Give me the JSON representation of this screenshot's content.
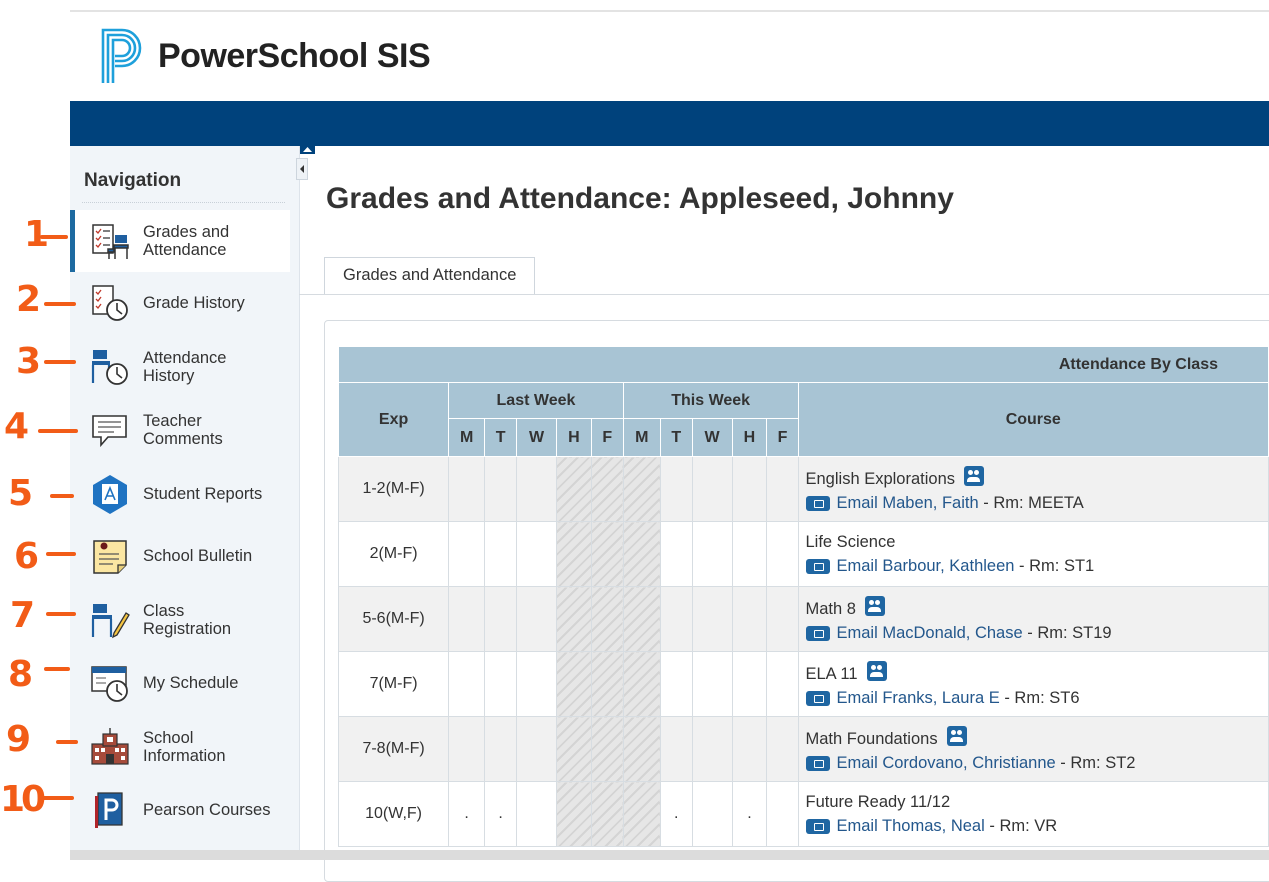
{
  "app": {
    "logo_text": "PowerSchool SIS"
  },
  "sidebar": {
    "title": "Navigation",
    "items": [
      {
        "label": "Grades and Attendance",
        "icon": "grades-attendance-icon"
      },
      {
        "label": "Grade History",
        "icon": "grade-history-icon"
      },
      {
        "label": "Attendance History",
        "icon": "attendance-history-icon"
      },
      {
        "label": "Teacher Comments",
        "icon": "speech-bubble-icon"
      },
      {
        "label": "Student Reports",
        "icon": "student-reports-icon"
      },
      {
        "label": "School Bulletin",
        "icon": "bulletin-icon"
      },
      {
        "label": "Class Registration",
        "icon": "class-registration-icon"
      },
      {
        "label": "My Schedule",
        "icon": "schedule-icon"
      },
      {
        "label": "School Information",
        "icon": "school-icon"
      },
      {
        "label": "Pearson Courses",
        "icon": "pearson-book-icon"
      }
    ]
  },
  "annotations": [
    "1",
    "2",
    "3",
    "4",
    "5",
    "6",
    "7",
    "8",
    "9",
    "10"
  ],
  "main": {
    "title": "Grades and Attendance: Appleseed, Johnny",
    "tab": "Grades and Attendance",
    "table": {
      "caption": "Attendance By Class",
      "exp_header": "Exp",
      "last_week": "Last Week",
      "this_week": "This Week",
      "course_header": "Course",
      "days": [
        "M",
        "T",
        "W",
        "H",
        "F",
        "M",
        "T",
        "W",
        "H",
        "F"
      ],
      "rows": [
        {
          "exp": "1-2(M-F)",
          "course": "English Explorations",
          "roster": true,
          "teacher": "Email Maben, Faith",
          "room": "- Rm: MEETA",
          "marks": [
            "",
            "",
            "",
            "",
            "",
            "",
            "",
            "",
            "",
            ""
          ]
        },
        {
          "exp": "2(M-F)",
          "course": "Life Science",
          "roster": false,
          "teacher": "Email Barbour, Kathleen",
          "room": "- Rm: ST1",
          "marks": [
            "",
            "",
            "",
            "",
            "",
            "",
            "",
            "",
            "",
            ""
          ]
        },
        {
          "exp": "5-6(M-F)",
          "course": "Math 8",
          "roster": true,
          "teacher": "Email MacDonald, Chase",
          "room": "- Rm: ST19",
          "marks": [
            "",
            "",
            "",
            "",
            "",
            "",
            "",
            "",
            "",
            ""
          ]
        },
        {
          "exp": "7(M-F)",
          "course": "ELA 11",
          "roster": true,
          "teacher": "Email Franks, Laura E",
          "room": "- Rm: ST6",
          "marks": [
            "",
            "",
            "",
            "",
            "",
            "",
            "",
            "",
            "",
            ""
          ]
        },
        {
          "exp": "7-8(M-F)",
          "course": "Math Foundations",
          "roster": true,
          "teacher": "Email Cordovano, Christianne",
          "room": "- Rm: ST2",
          "marks": [
            "",
            "",
            "",
            "",
            "",
            "",
            "",
            "",
            "",
            ""
          ]
        },
        {
          "exp": "10(W,F)",
          "course": "Future Ready 11/12",
          "roster": false,
          "teacher": "Email Thomas, Neal",
          "room": "- Rm: VR",
          "marks": [
            ".",
            ".",
            "",
            "",
            "",
            "",
            ".",
            "",
            ".",
            ""
          ]
        }
      ]
    }
  },
  "colors": {
    "brand": "#00427c",
    "table_header": "#a8c4d4",
    "link": "#23578c",
    "annotation": "#f25c17"
  }
}
